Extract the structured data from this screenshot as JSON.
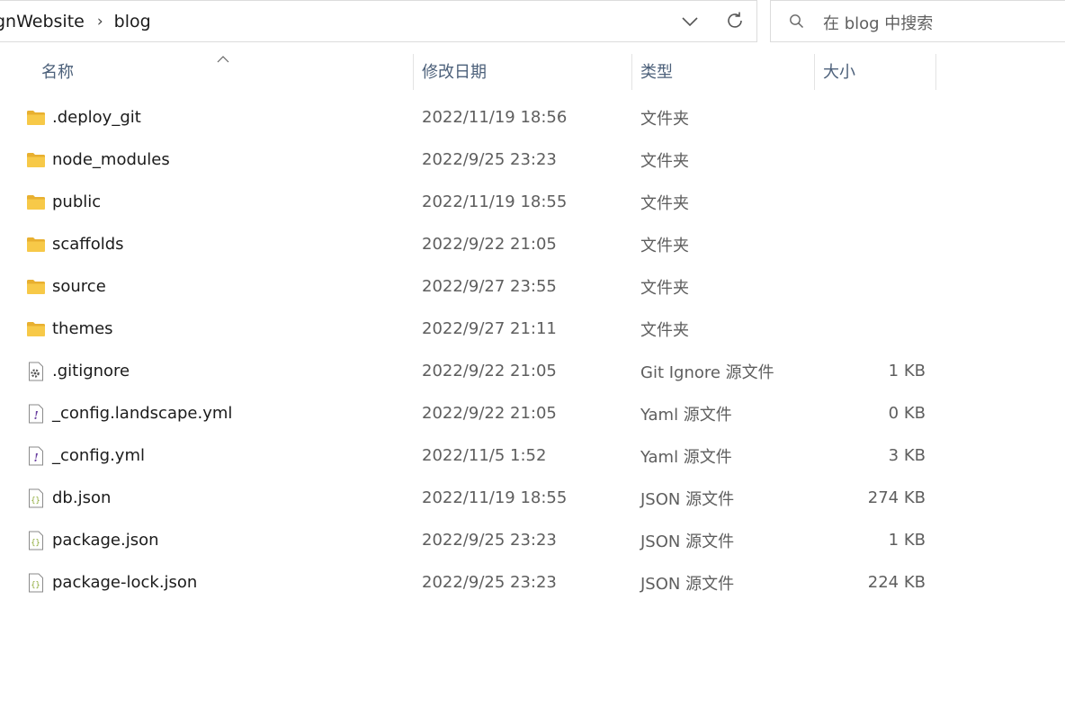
{
  "breadcrumb": {
    "items": [
      "gnWebsite",
      "blog"
    ],
    "separator": "›"
  },
  "search": {
    "placeholder": "在 blog 中搜索"
  },
  "columns": {
    "name": "名称",
    "modified": "修改日期",
    "type": "类型",
    "size": "大小"
  },
  "sort": {
    "column": "name",
    "direction": "ascending"
  },
  "colors": {
    "folder": "#f5c542",
    "folder_tab": "#e8b030",
    "header_text": "#4c607a",
    "json_icon": "#8aa832",
    "yaml_icon": "#6a3fa0"
  },
  "files": [
    {
      "name": ".deploy_git",
      "modified": "2022/11/19 18:56",
      "type": "文件夹",
      "size": "",
      "icon": "folder-icon"
    },
    {
      "name": "node_modules",
      "modified": "2022/9/25 23:23",
      "type": "文件夹",
      "size": "",
      "icon": "folder-icon"
    },
    {
      "name": "public",
      "modified": "2022/11/19 18:55",
      "type": "文件夹",
      "size": "",
      "icon": "folder-icon"
    },
    {
      "name": "scaffolds",
      "modified": "2022/9/22 21:05",
      "type": "文件夹",
      "size": "",
      "icon": "folder-icon"
    },
    {
      "name": "source",
      "modified": "2022/9/27 23:55",
      "type": "文件夹",
      "size": "",
      "icon": "folder-icon"
    },
    {
      "name": "themes",
      "modified": "2022/9/27 21:11",
      "type": "文件夹",
      "size": "",
      "icon": "folder-icon"
    },
    {
      "name": ".gitignore",
      "modified": "2022/9/22 21:05",
      "type": "Git Ignore 源文件",
      "size": "1 KB",
      "icon": "gear-file-icon"
    },
    {
      "name": "_config.landscape.yml",
      "modified": "2022/9/22 21:05",
      "type": "Yaml 源文件",
      "size": "0 KB",
      "icon": "yaml-file-icon"
    },
    {
      "name": "_config.yml",
      "modified": "2022/11/5 1:52",
      "type": "Yaml 源文件",
      "size": "3 KB",
      "icon": "yaml-file-icon"
    },
    {
      "name": "db.json",
      "modified": "2022/11/19 18:55",
      "type": "JSON 源文件",
      "size": "274 KB",
      "icon": "json-file-icon"
    },
    {
      "name": "package.json",
      "modified": "2022/9/25 23:23",
      "type": "JSON 源文件",
      "size": "1 KB",
      "icon": "json-file-icon"
    },
    {
      "name": "package-lock.json",
      "modified": "2022/9/25 23:23",
      "type": "JSON 源文件",
      "size": "224 KB",
      "icon": "json-file-icon"
    }
  ]
}
